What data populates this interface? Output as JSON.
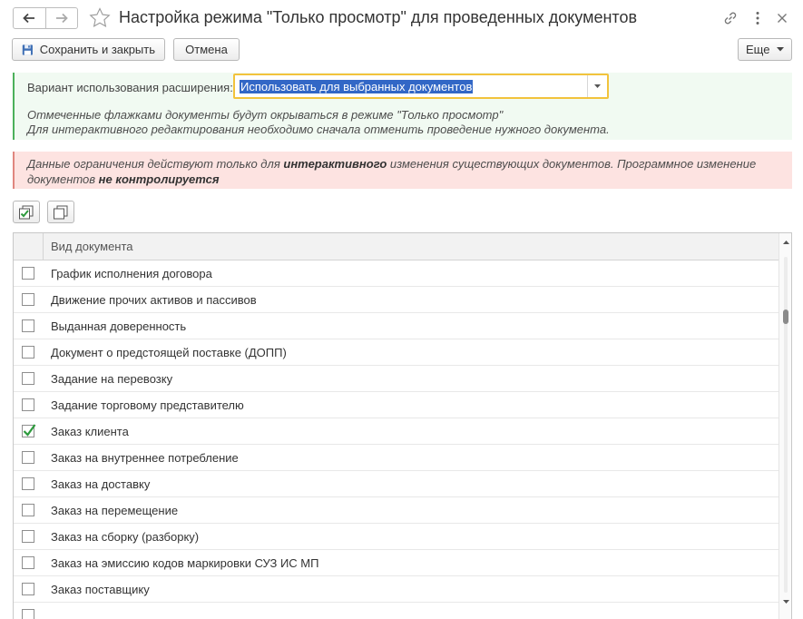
{
  "window": {
    "title": "Настройка режима \"Только просмотр\" для проведенных документов",
    "icons": {
      "back": "arrow-left-icon",
      "forward": "arrow-right-icon",
      "favorite": "star-icon",
      "link": "link-icon",
      "menu": "more-vertical-icon",
      "close": "close-icon"
    }
  },
  "toolbar": {
    "save_label": "Сохранить и закрыть",
    "cancel_label": "Отмена",
    "more_label": "Еще"
  },
  "settings": {
    "variant_label": "Вариант использования расширения:",
    "variant_value": "Использовать для выбранных документов",
    "note_line1": "Отмеченные флажками документы будут окрываться в режиме \"Только просмотр\"",
    "note_line2": "Для интерактивного редактирования необходимо сначала отменить проведение нужного документа."
  },
  "warning": {
    "part1": "Данные ограничения действуют только для ",
    "bold1": "интерактивного",
    "part2": " изменения существующих документов. Программное изменение",
    "part3": "документов ",
    "bold2": "не контролируется"
  },
  "table": {
    "column_header": "Вид документа",
    "rows": [
      {
        "label": "График исполнения договора",
        "checked": false
      },
      {
        "label": "Движение прочих активов и пассивов",
        "checked": false
      },
      {
        "label": "Выданная доверенность",
        "checked": false
      },
      {
        "label": "Документ о предстоящей поставке (ДОПП)",
        "checked": false
      },
      {
        "label": "Задание на перевозку",
        "checked": false
      },
      {
        "label": "Задание торговому представителю",
        "checked": false
      },
      {
        "label": "Заказ клиента",
        "checked": true
      },
      {
        "label": "Заказ на внутреннее потребление",
        "checked": false
      },
      {
        "label": "Заказ на доставку",
        "checked": false
      },
      {
        "label": "Заказ на перемещение",
        "checked": false
      },
      {
        "label": "Заказ на сборку (разборку)",
        "checked": false
      },
      {
        "label": "Заказ на эмиссию кодов маркировки СУЗ ИС МП",
        "checked": false
      },
      {
        "label": "Заказ поставщику",
        "checked": false
      },
      {
        "label": "",
        "checked": false
      }
    ]
  },
  "colors": {
    "accent_selection": "#3267c6",
    "focus_border": "#f2c33c",
    "info_bg": "#f1faf2",
    "warning_bg": "#fde3e1"
  }
}
